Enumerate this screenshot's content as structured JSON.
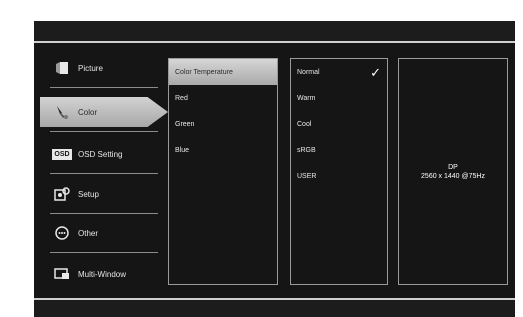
{
  "menu": [
    {
      "label": "Picture",
      "icon": "picture-icon"
    },
    {
      "label": "Color",
      "icon": "color-icon"
    },
    {
      "label": "OSD Setting",
      "icon": "osd-icon",
      "icon_text": "OSD"
    },
    {
      "label": "Setup",
      "icon": "setup-icon"
    },
    {
      "label": "Other",
      "icon": "other-icon"
    },
    {
      "label": "Multi-Window",
      "icon": "multi-window-icon"
    }
  ],
  "submenu": [
    "Color Temperature",
    "Red",
    "Green",
    "Blue"
  ],
  "options": {
    "items": [
      "Normal",
      "Warm",
      "Cool",
      "sRGB",
      "USER"
    ],
    "check": "✓"
  },
  "info": {
    "input": "DP",
    "resolution": "2560 x 1440 @75Hz"
  }
}
